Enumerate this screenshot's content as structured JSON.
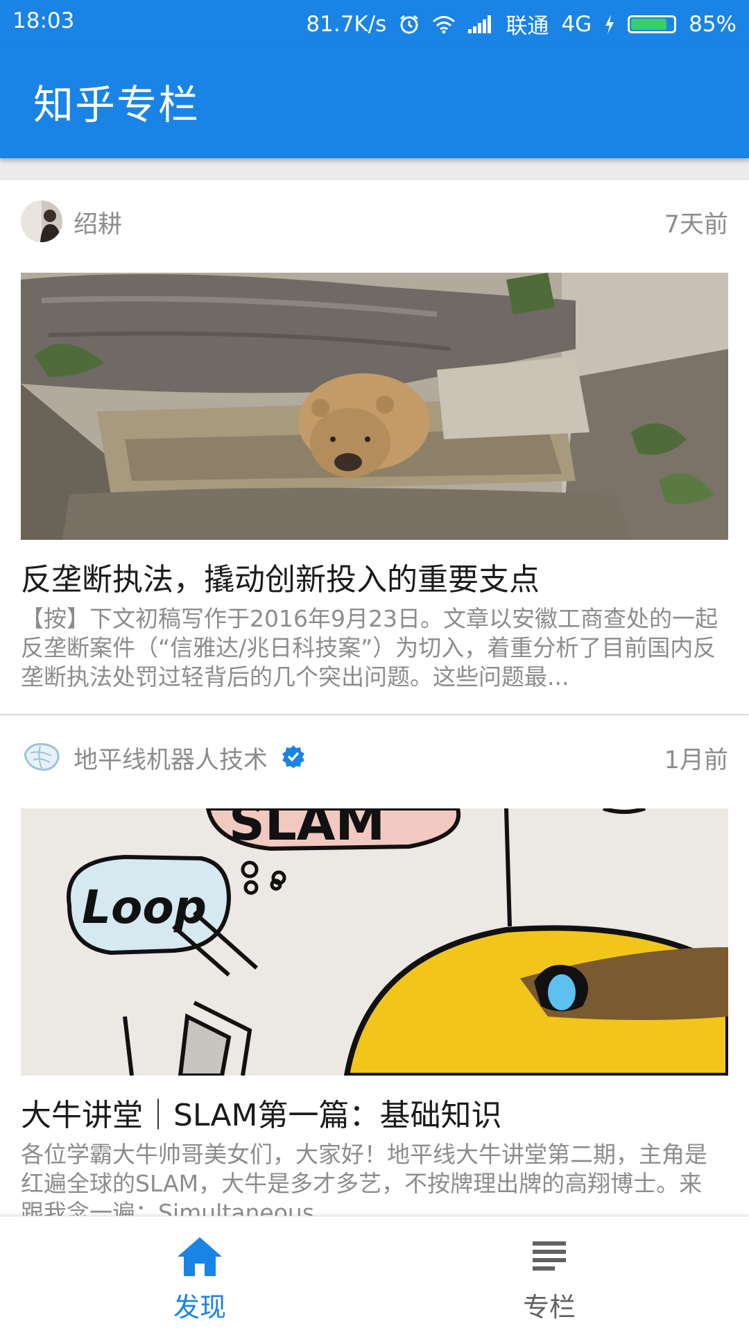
{
  "status_bar": {
    "time": "18:03",
    "net_speed": "81.7K/s",
    "carrier": "联通",
    "network": "4G",
    "battery_percent": "85%",
    "battery_level": 0.85,
    "icons": [
      "alarm-icon",
      "wifi-icon",
      "signal-icon",
      "charging-icon",
      "battery-icon"
    ]
  },
  "app_bar": {
    "title": "知乎专栏"
  },
  "articles": [
    {
      "author": "绍耕",
      "verified": false,
      "time": "7天前",
      "image": "bear-in-water-photo",
      "title": "反垄断执法，撬动创新投入的重要支点",
      "excerpt": "【按】下文初稿写作于2016年9月23日。文章以安徽工商查处的一起反垄断案件（“信雅达/兆日科技案”）为切入，着重分析了目前国内反垄断执法处罚过轻背后的几个突出问题。这些问题最..."
    },
    {
      "author": "地平线机器人技术",
      "verified": true,
      "time": "1月前",
      "image": "slam-loop-cartoon",
      "image_text": {
        "bubble_top": "SLAM",
        "bubble_left": "Loop"
      },
      "title": "大牛讲堂｜SLAM第一篇：基础知识",
      "excerpt": "各位学霸大牛帅哥美女们，大家好！地平线大牛讲堂第二期，主角是红遍全球的SLAM，大牛是多才多艺，不按牌理出牌的高翔博士。来 跟我念一遍：Simultaneous..."
    }
  ],
  "bottom_nav": {
    "items": [
      {
        "label": "发现",
        "icon": "home-icon",
        "active": true
      },
      {
        "label": "专栏",
        "icon": "list-icon",
        "active": false
      }
    ]
  },
  "colors": {
    "primary": "#1a83e6",
    "active_nav": "#1a83e6",
    "inactive_nav": "#616161",
    "title_text": "#1b1b1b",
    "secondary_text": "#8c8c8c"
  }
}
